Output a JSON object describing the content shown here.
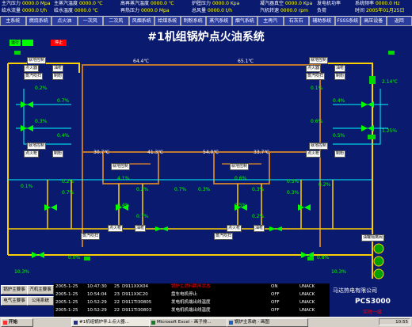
{
  "status": {
    "rows": [
      [
        {
          "label": "主汽压力",
          "value": "0000.0 Mpa"
        },
        {
          "label": "主蒸汽温度",
          "value": "0000.0 ℃"
        },
        {
          "label": "高再蒸汽温度",
          "value": "0000.0 ℃"
        },
        {
          "label": "炉膛压力",
          "value": "0000.0 Kpa"
        },
        {
          "label": "凝汽器真空",
          "value": "0000.0 Kpa"
        },
        {
          "label": "系统频率",
          "value": "0000.0 Hz"
        }
      ],
      [
        {
          "label": "给水流量",
          "value": "0000.0 t/h"
        },
        {
          "label": "给水温度",
          "value": "0000.0 ℃"
        },
        {
          "label": "再热压力",
          "value": "0000.0 Mpa"
        },
        {
          "label": "总风量",
          "value": "0000.0 t/h"
        },
        {
          "label": "汽机转速",
          "value": "0000.0 rpm"
        },
        {
          "label": "时间",
          "value": "2005年01月25日"
        }
      ]
    ],
    "extra": [
      {
        "label": "发电机功率",
        "value": "0000.0 MW"
      },
      {
        "label": "负荷",
        "value": "0000.0 MW"
      }
    ]
  },
  "nav": [
    "主系统",
    "燃烧系统",
    "点火油",
    "一次风",
    "二次风",
    "风烟系统",
    "给煤系统",
    "制粉系统",
    "蒸汽系统",
    "烟气系统",
    "主再汽",
    "石灰石",
    "辅助系统",
    "FSSS系统",
    "高压设备",
    "返回"
  ],
  "title": "#1机组锅炉点火油系统",
  "legend": {
    "on": "运行",
    "off": "停止"
  },
  "top_temps": {
    "left": "64.4℃",
    "right": "65.1℃"
  },
  "mid_temps": [
    "30.7℃",
    "41.3℃",
    "54.0℃",
    "33.7℃"
  ],
  "right_side": {
    "v1": "2.14℃",
    "v2": "1.25%",
    "tag": "油罐隔离阀"
  },
  "left_values": [
    "0.2%",
    "0.7%",
    "0.3%",
    "0.4%",
    "0.2%",
    "0.7%",
    "0.1%",
    "0.0%"
  ],
  "right_values": [
    "0.1%",
    "0.4%",
    "0.6%",
    "0.5%",
    "0.5%",
    "0.3%",
    "0.2%",
    "0.8%"
  ],
  "center_values": [
    "4.1%",
    "0.2%",
    "0.4%",
    "0.7%",
    "0.6%",
    "0.3%",
    "0.5%",
    "0.2%",
    "0.7%",
    "0.3%"
  ],
  "bottom_values": {
    "left": "0.0%",
    "right": "10.3%",
    "left2": "10.3%"
  },
  "tags": {
    "valve": "就地控制",
    "fan": "制粉",
    "oil": "油枪",
    "cap": "蒸汽吹扫",
    "ign": "点火枪",
    "ignite": "点火器",
    "pos": "就地控制"
  },
  "alarms": [
    {
      "date": "2005-1-25",
      "time": "10:47:30",
      "num": "25",
      "code": "D911XXX04",
      "desc": "锅炉主燃料跳闸状态",
      "state": "ON",
      "ack": "UNACK"
    },
    {
      "date": "2005-1-25",
      "time": "10:54:04",
      "num": "23",
      "code": "D911XXC20",
      "desc": "盘车电机停止",
      "state": "OFF",
      "ack": "UNACK"
    },
    {
      "date": "2005-1-25",
      "time": "10:52:29",
      "num": "22",
      "code": "D911TI30805",
      "desc": "发电机机端出线温度",
      "state": "OFF",
      "ack": "UNACK"
    },
    {
      "date": "2005-1-25",
      "time": "10:52:29",
      "num": "22",
      "code": "D911TI30803",
      "desc": "发电机机端出线温度",
      "state": "OFF",
      "ack": "UNACK"
    }
  ],
  "left_buttons": [
    "锅炉主要事",
    "汽机主要事",
    "电气主要事",
    "公用系统"
  ],
  "logo": {
    "company": "马达热电有限公司",
    "product": "PCS3000",
    "sub": "实时一级"
  },
  "taskbar": {
    "start": "开始",
    "items": [
      "#1机组锅炉伴上点火器...",
      "Microsoft Excel - 画子排...",
      "锅炉主系统 - 画图"
    ],
    "clock": "10:55"
  },
  "colors": {
    "bg": "#0a1a6e",
    "pipe_yellow": "#ffd000",
    "pipe_blue": "#00ffff",
    "pipe_brown": "#c07830",
    "green": "#00ff00",
    "red": "#ff0000"
  }
}
